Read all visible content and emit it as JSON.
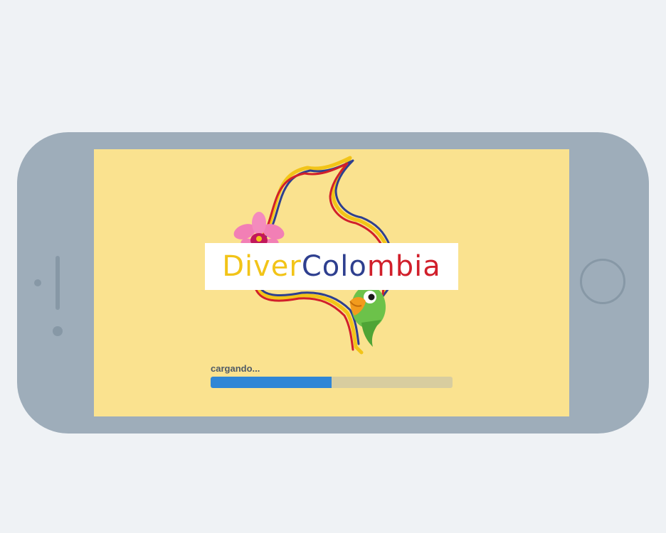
{
  "app": {
    "logo": {
      "word_part1": "Diver",
      "word_part2": "Col",
      "word_part3": "o",
      "word_part4": "mbia",
      "colors": {
        "yellow": "#f2c418",
        "blue": "#2e3f8f",
        "red": "#d11f2b"
      },
      "icons": [
        "colombia-map-icon",
        "orchid-flower-icon",
        "parrot-icon"
      ]
    },
    "loading": {
      "label": "cargando...",
      "progress": 0.5
    }
  },
  "colors": {
    "page_bg": "#eff2f5",
    "device_body": "#9eadba",
    "screen_bg": "#fae28f",
    "progress_fill": "#2f86d6",
    "progress_track": "#d8cd9f"
  }
}
